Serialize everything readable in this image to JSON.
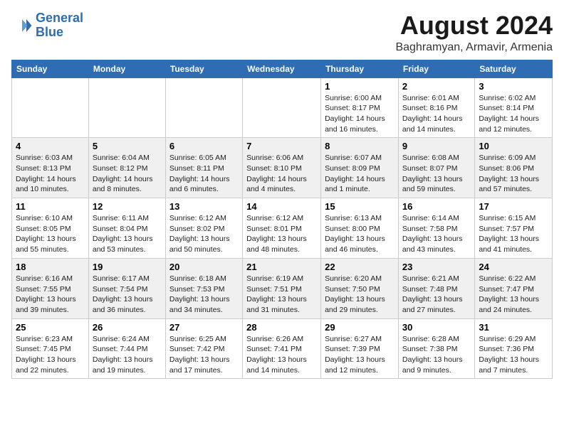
{
  "header": {
    "logo_line1": "General",
    "logo_line2": "Blue",
    "month_title": "August 2024",
    "location": "Baghramyan, Armavir, Armenia"
  },
  "weekdays": [
    "Sunday",
    "Monday",
    "Tuesday",
    "Wednesday",
    "Thursday",
    "Friday",
    "Saturday"
  ],
  "weeks": [
    [
      {
        "day": "",
        "sunrise": "",
        "sunset": "",
        "daylight": ""
      },
      {
        "day": "",
        "sunrise": "",
        "sunset": "",
        "daylight": ""
      },
      {
        "day": "",
        "sunrise": "",
        "sunset": "",
        "daylight": ""
      },
      {
        "day": "",
        "sunrise": "",
        "sunset": "",
        "daylight": ""
      },
      {
        "day": "1",
        "sunrise": "Sunrise: 6:00 AM",
        "sunset": "Sunset: 8:17 PM",
        "daylight": "Daylight: 14 hours and 16 minutes."
      },
      {
        "day": "2",
        "sunrise": "Sunrise: 6:01 AM",
        "sunset": "Sunset: 8:16 PM",
        "daylight": "Daylight: 14 hours and 14 minutes."
      },
      {
        "day": "3",
        "sunrise": "Sunrise: 6:02 AM",
        "sunset": "Sunset: 8:14 PM",
        "daylight": "Daylight: 14 hours and 12 minutes."
      }
    ],
    [
      {
        "day": "4",
        "sunrise": "Sunrise: 6:03 AM",
        "sunset": "Sunset: 8:13 PM",
        "daylight": "Daylight: 14 hours and 10 minutes."
      },
      {
        "day": "5",
        "sunrise": "Sunrise: 6:04 AM",
        "sunset": "Sunset: 8:12 PM",
        "daylight": "Daylight: 14 hours and 8 minutes."
      },
      {
        "day": "6",
        "sunrise": "Sunrise: 6:05 AM",
        "sunset": "Sunset: 8:11 PM",
        "daylight": "Daylight: 14 hours and 6 minutes."
      },
      {
        "day": "7",
        "sunrise": "Sunrise: 6:06 AM",
        "sunset": "Sunset: 8:10 PM",
        "daylight": "Daylight: 14 hours and 4 minutes."
      },
      {
        "day": "8",
        "sunrise": "Sunrise: 6:07 AM",
        "sunset": "Sunset: 8:09 PM",
        "daylight": "Daylight: 14 hours and 1 minute."
      },
      {
        "day": "9",
        "sunrise": "Sunrise: 6:08 AM",
        "sunset": "Sunset: 8:07 PM",
        "daylight": "Daylight: 13 hours and 59 minutes."
      },
      {
        "day": "10",
        "sunrise": "Sunrise: 6:09 AM",
        "sunset": "Sunset: 8:06 PM",
        "daylight": "Daylight: 13 hours and 57 minutes."
      }
    ],
    [
      {
        "day": "11",
        "sunrise": "Sunrise: 6:10 AM",
        "sunset": "Sunset: 8:05 PM",
        "daylight": "Daylight: 13 hours and 55 minutes."
      },
      {
        "day": "12",
        "sunrise": "Sunrise: 6:11 AM",
        "sunset": "Sunset: 8:04 PM",
        "daylight": "Daylight: 13 hours and 53 minutes."
      },
      {
        "day": "13",
        "sunrise": "Sunrise: 6:12 AM",
        "sunset": "Sunset: 8:02 PM",
        "daylight": "Daylight: 13 hours and 50 minutes."
      },
      {
        "day": "14",
        "sunrise": "Sunrise: 6:12 AM",
        "sunset": "Sunset: 8:01 PM",
        "daylight": "Daylight: 13 hours and 48 minutes."
      },
      {
        "day": "15",
        "sunrise": "Sunrise: 6:13 AM",
        "sunset": "Sunset: 8:00 PM",
        "daylight": "Daylight: 13 hours and 46 minutes."
      },
      {
        "day": "16",
        "sunrise": "Sunrise: 6:14 AM",
        "sunset": "Sunset: 7:58 PM",
        "daylight": "Daylight: 13 hours and 43 minutes."
      },
      {
        "day": "17",
        "sunrise": "Sunrise: 6:15 AM",
        "sunset": "Sunset: 7:57 PM",
        "daylight": "Daylight: 13 hours and 41 minutes."
      }
    ],
    [
      {
        "day": "18",
        "sunrise": "Sunrise: 6:16 AM",
        "sunset": "Sunset: 7:55 PM",
        "daylight": "Daylight: 13 hours and 39 minutes."
      },
      {
        "day": "19",
        "sunrise": "Sunrise: 6:17 AM",
        "sunset": "Sunset: 7:54 PM",
        "daylight": "Daylight: 13 hours and 36 minutes."
      },
      {
        "day": "20",
        "sunrise": "Sunrise: 6:18 AM",
        "sunset": "Sunset: 7:53 PM",
        "daylight": "Daylight: 13 hours and 34 minutes."
      },
      {
        "day": "21",
        "sunrise": "Sunrise: 6:19 AM",
        "sunset": "Sunset: 7:51 PM",
        "daylight": "Daylight: 13 hours and 31 minutes."
      },
      {
        "day": "22",
        "sunrise": "Sunrise: 6:20 AM",
        "sunset": "Sunset: 7:50 PM",
        "daylight": "Daylight: 13 hours and 29 minutes."
      },
      {
        "day": "23",
        "sunrise": "Sunrise: 6:21 AM",
        "sunset": "Sunset: 7:48 PM",
        "daylight": "Daylight: 13 hours and 27 minutes."
      },
      {
        "day": "24",
        "sunrise": "Sunrise: 6:22 AM",
        "sunset": "Sunset: 7:47 PM",
        "daylight": "Daylight: 13 hours and 24 minutes."
      }
    ],
    [
      {
        "day": "25",
        "sunrise": "Sunrise: 6:23 AM",
        "sunset": "Sunset: 7:45 PM",
        "daylight": "Daylight: 13 hours and 22 minutes."
      },
      {
        "day": "26",
        "sunrise": "Sunrise: 6:24 AM",
        "sunset": "Sunset: 7:44 PM",
        "daylight": "Daylight: 13 hours and 19 minutes."
      },
      {
        "day": "27",
        "sunrise": "Sunrise: 6:25 AM",
        "sunset": "Sunset: 7:42 PM",
        "daylight": "Daylight: 13 hours and 17 minutes."
      },
      {
        "day": "28",
        "sunrise": "Sunrise: 6:26 AM",
        "sunset": "Sunset: 7:41 PM",
        "daylight": "Daylight: 13 hours and 14 minutes."
      },
      {
        "day": "29",
        "sunrise": "Sunrise: 6:27 AM",
        "sunset": "Sunset: 7:39 PM",
        "daylight": "Daylight: 13 hours and 12 minutes."
      },
      {
        "day": "30",
        "sunrise": "Sunrise: 6:28 AM",
        "sunset": "Sunset: 7:38 PM",
        "daylight": "Daylight: 13 hours and 9 minutes."
      },
      {
        "day": "31",
        "sunrise": "Sunrise: 6:29 AM",
        "sunset": "Sunset: 7:36 PM",
        "daylight": "Daylight: 13 hours and 7 minutes."
      }
    ]
  ]
}
